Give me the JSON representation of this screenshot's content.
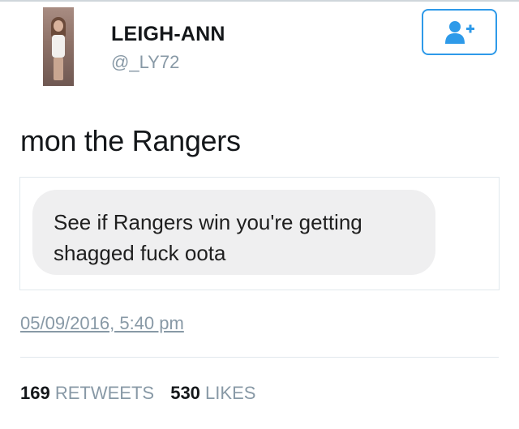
{
  "user": {
    "display_name": "LEIGH-ANN",
    "handle": "@_LY72"
  },
  "tweet": {
    "text": "mon the Rangers",
    "media_text": "See if Rangers win you're getting shagged fuck oota",
    "timestamp": "05/09/2016, 5:40 pm"
  },
  "stats": {
    "retweets_count": "169",
    "retweets_label": "RETWEETS",
    "likes_count": "530",
    "likes_label": "LIKES"
  },
  "icons": {
    "follow": "add-user-icon"
  },
  "colors": {
    "accent": "#2e9ae9",
    "muted": "#8899a6",
    "text": "#14171a",
    "bubble": "#efeff0"
  }
}
